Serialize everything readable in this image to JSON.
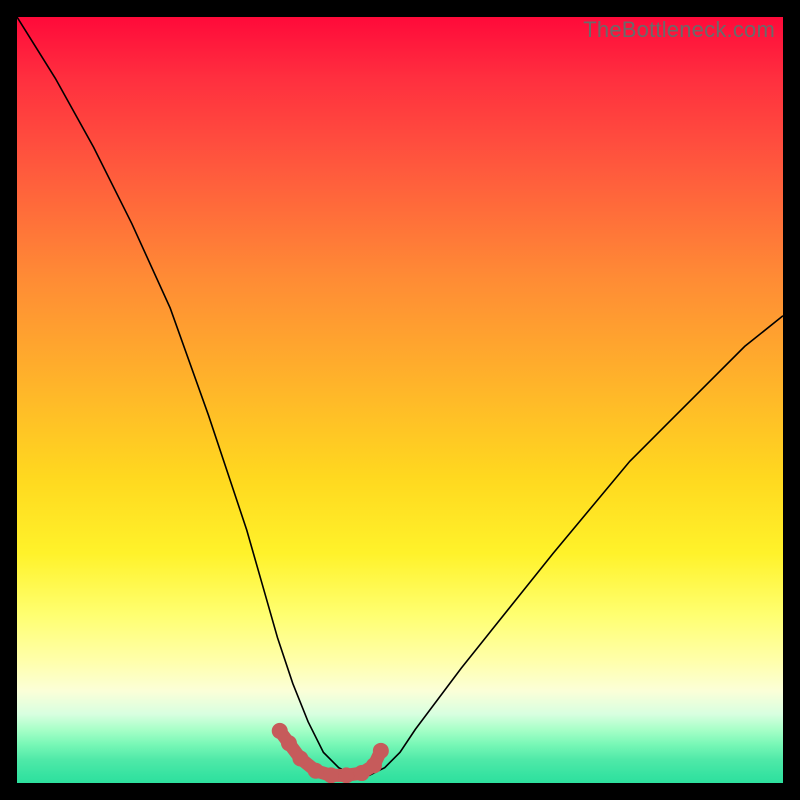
{
  "watermark": {
    "text": "TheBottleneck.com"
  },
  "chart_data": {
    "type": "line",
    "title": "",
    "xlabel": "",
    "ylabel": "",
    "xlim": [
      0,
      100
    ],
    "ylim": [
      0,
      100
    ],
    "series": [
      {
        "name": "bottleneck-curve",
        "notes": "V-shaped curve with minimum near x≈40–47; left arm starts near top-left, right arm rises to ≈60% height at right edge",
        "x": [
          0,
          5,
          10,
          15,
          20,
          25,
          28,
          30,
          32,
          34,
          36,
          38,
          40,
          42,
          44,
          46,
          48,
          50,
          52,
          55,
          58,
          62,
          66,
          70,
          75,
          80,
          85,
          90,
          95,
          100
        ],
        "y": [
          100,
          92,
          83,
          73,
          62,
          48,
          39,
          33,
          26,
          19,
          13,
          8,
          4,
          2,
          1,
          1,
          2,
          4,
          7,
          11,
          15,
          20,
          25,
          30,
          36,
          42,
          47,
          52,
          57,
          61
        ]
      }
    ],
    "highlight": {
      "name": "valley-highlight",
      "color": "#c65b5b",
      "x": [
        34.3,
        35.5,
        37,
        39,
        41,
        43,
        45,
        46.6,
        47.5
      ],
      "y": [
        6.8,
        5.2,
        3.2,
        1.6,
        1.0,
        1.0,
        1.3,
        2.3,
        4.2
      ]
    }
  }
}
